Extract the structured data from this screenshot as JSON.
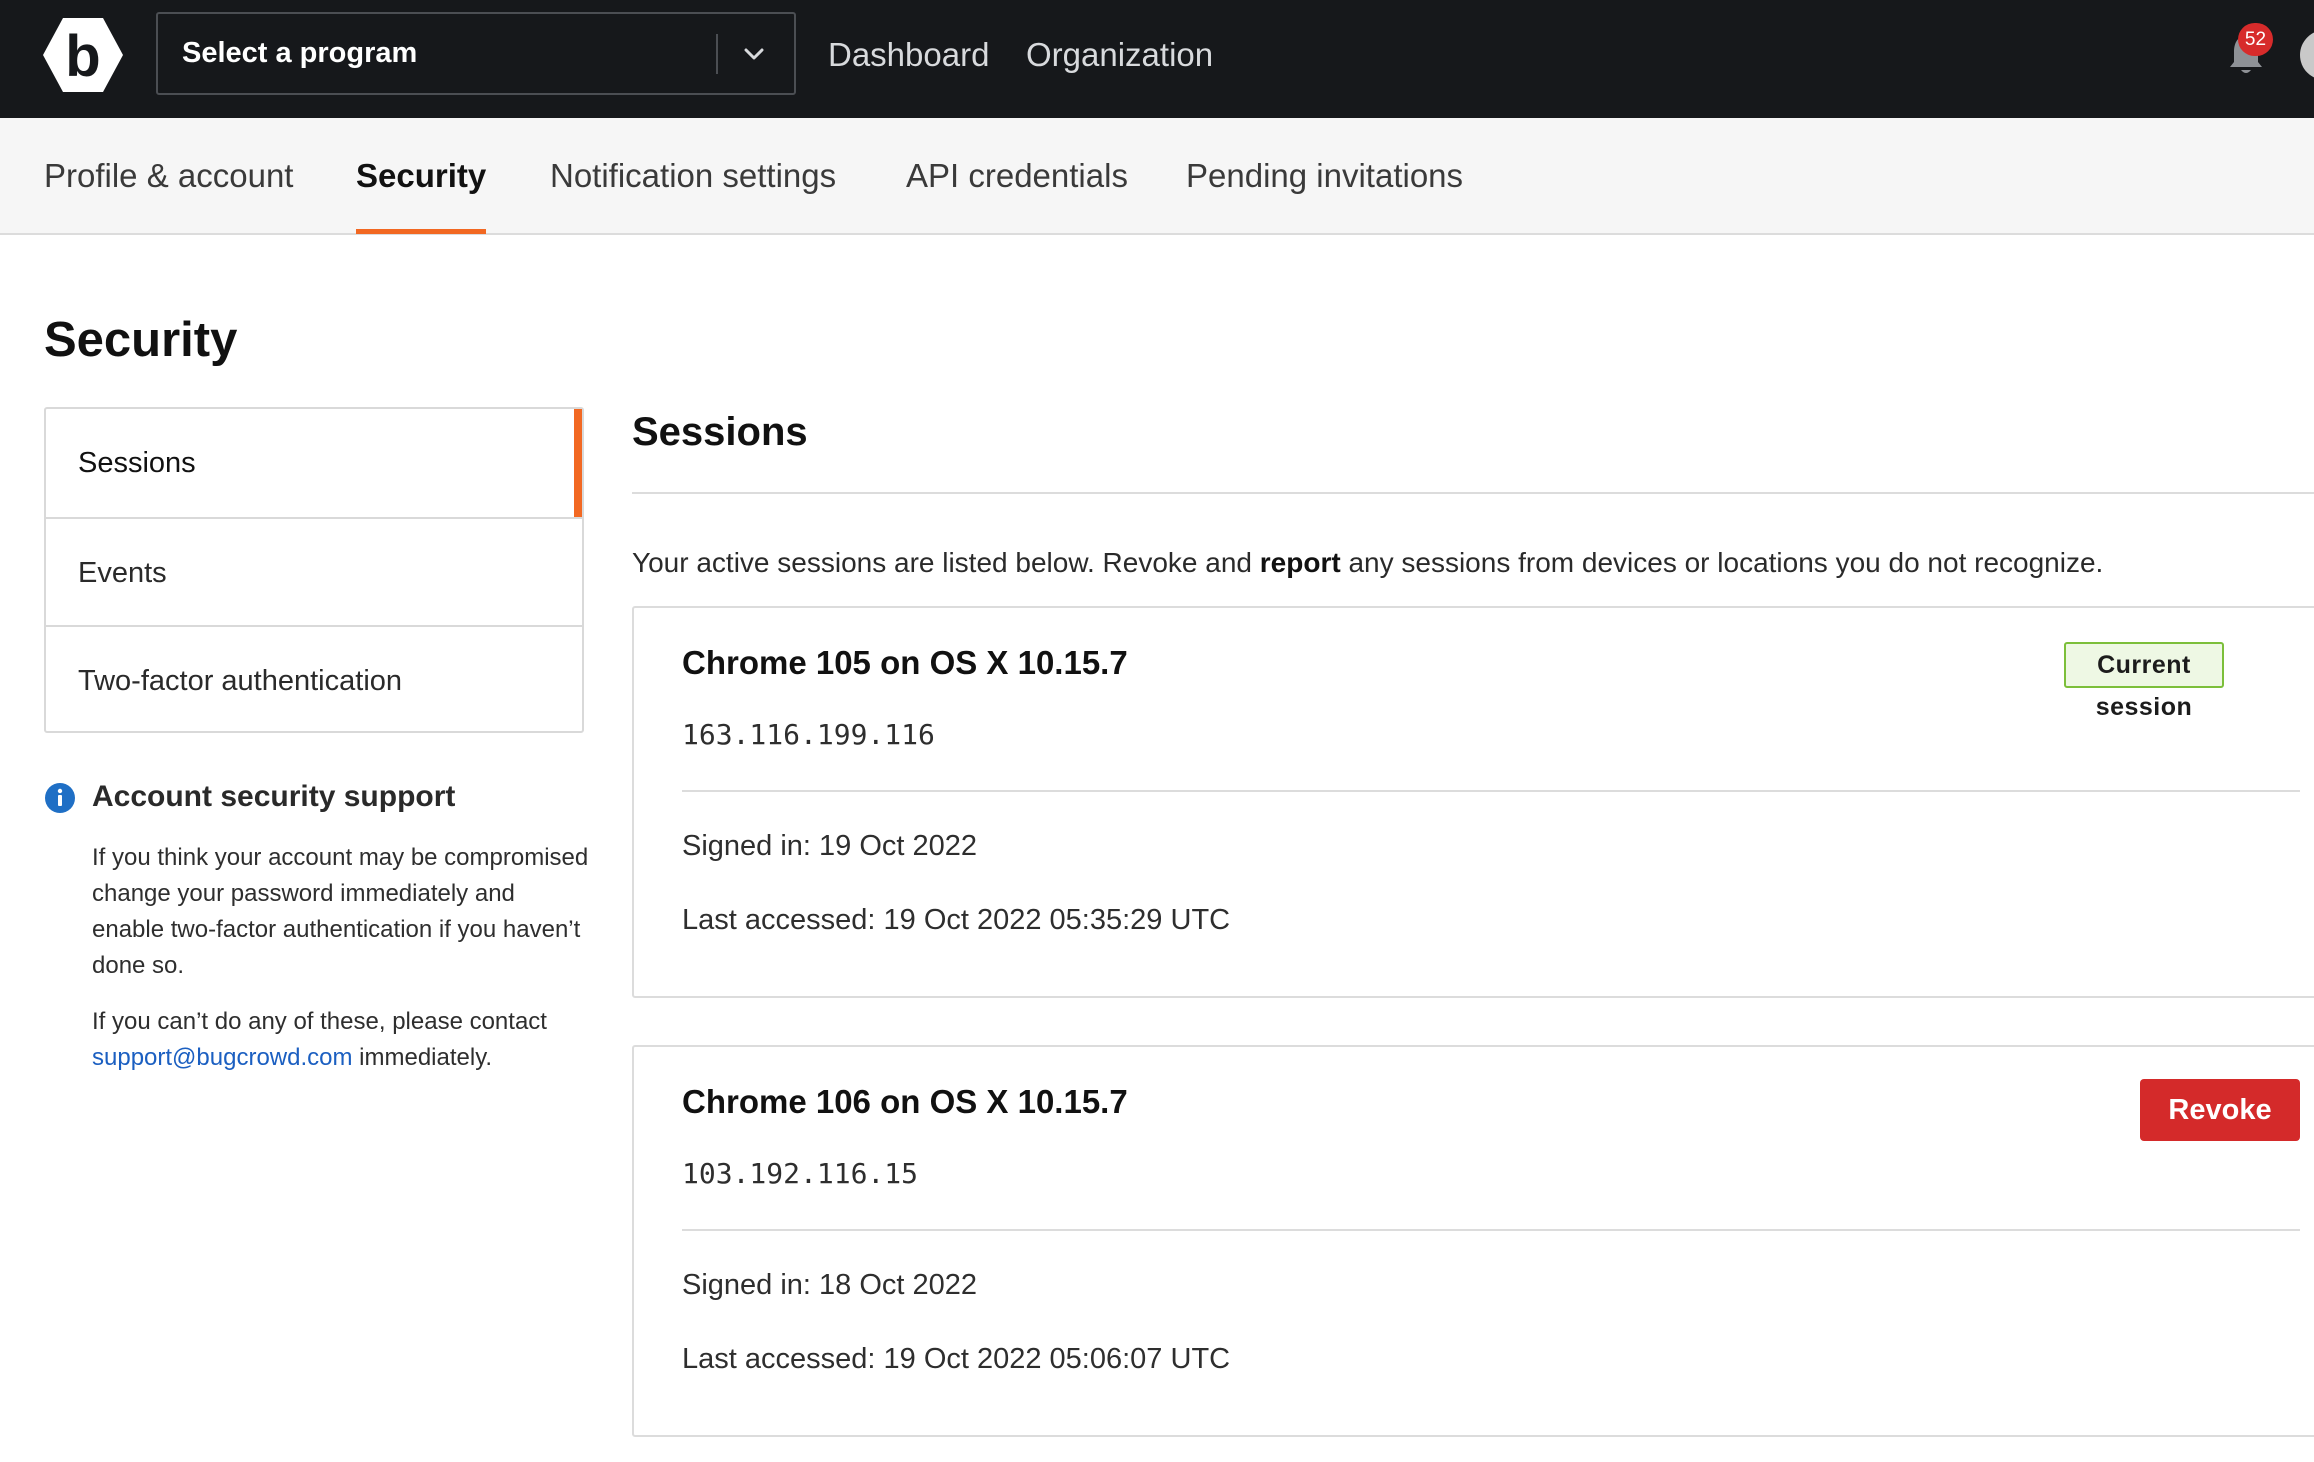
{
  "topbar": {
    "program_select_label": "Select a program",
    "nav": [
      "Dashboard",
      "Organization"
    ],
    "notification_count": "52"
  },
  "tabs": [
    {
      "label": "Profile & account",
      "active": false
    },
    {
      "label": "Security",
      "active": true
    },
    {
      "label": "Notification settings",
      "active": false
    },
    {
      "label": "API credentials",
      "active": false
    },
    {
      "label": "Pending invitations",
      "active": false
    }
  ],
  "page_title": "Security",
  "sidemenu": [
    {
      "label": "Sessions",
      "active": true
    },
    {
      "label": "Events",
      "active": false
    },
    {
      "label": "Two-factor authentication",
      "active": false
    }
  ],
  "support": {
    "title": "Account security support",
    "para1": "If you think your account may be compromised change your password immediately and enable two-factor authentication if you haven’t done so.",
    "para2_prefix": "If you can’t do any of these, please contact",
    "email": "support@bugcrowd.com",
    "para2_suffix": "immediately."
  },
  "sessions": {
    "heading": "Sessions",
    "intro_prefix": "Your active sessions are listed below. Revoke and",
    "intro_bold": "report",
    "intro_suffix": "any sessions from devices or locations you do not recognize.",
    "items": [
      {
        "title": "Chrome 105 on OS X 10.15.7",
        "ip": "163.116.199.116",
        "signed_in": "Signed in: 19 Oct 2022",
        "last_accessed": "Last accessed: 19 Oct 2022 05:35:29 UTC",
        "badge": "Current session"
      },
      {
        "title": "Chrome 106 on OS X 10.15.7",
        "ip": "103.192.116.15",
        "signed_in": "Signed in: 18 Oct 2022",
        "last_accessed": "Last accessed: 19 Oct 2022 05:06:07 UTC",
        "action": "Revoke"
      }
    ]
  },
  "colors": {
    "topbar": "#16181b",
    "accent": "#f26822",
    "revoke": "#d42a2a",
    "current_badge_border": "#7cbf3a",
    "link": "#1b5fc1"
  }
}
